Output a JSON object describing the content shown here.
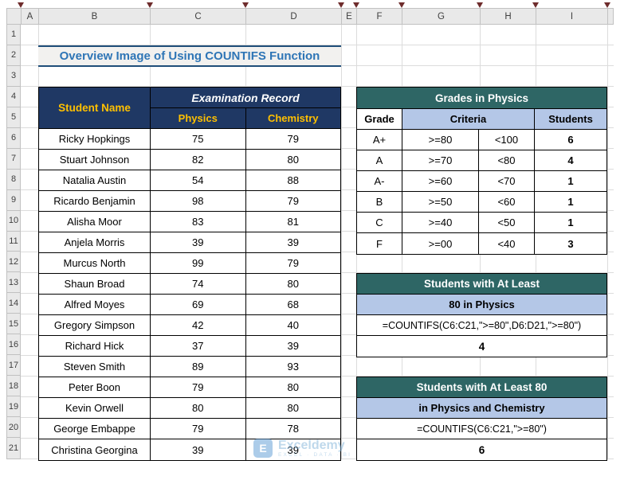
{
  "colors": {
    "navy_header": "#1F3864",
    "gold_text": "#FFC000",
    "teal_header": "#2E6665",
    "light_blue": "#B4C7E7",
    "title_text": "#2E75B6",
    "title_border": "#1F4E79"
  },
  "column_headers": [
    "A",
    "B",
    "C",
    "D",
    "E",
    "F",
    "G",
    "H",
    "I"
  ],
  "row_numbers": [
    "1",
    "2",
    "3",
    "4",
    "5",
    "6",
    "7",
    "8",
    "9",
    "10",
    "11",
    "12",
    "13",
    "14",
    "15",
    "16",
    "17",
    "18",
    "19",
    "20",
    "21"
  ],
  "title": "Overview Image of Using COUNTIFS Function",
  "student_table": {
    "name_header": "Student Name",
    "group_header": "Examination Record",
    "col_physics": "Physics",
    "col_chemistry": "Chemistry",
    "rows": [
      [
        "Ricky Hopkings",
        "75",
        "79"
      ],
      [
        "Stuart Johnson",
        "82",
        "80"
      ],
      [
        "Natalia Austin",
        "54",
        "88"
      ],
      [
        "Ricardo Benjamin",
        "98",
        "79"
      ],
      [
        "Alisha Moor",
        "83",
        "81"
      ],
      [
        "Anjela Morris",
        "39",
        "39"
      ],
      [
        "Murcus North",
        "99",
        "79"
      ],
      [
        "Shaun Broad",
        "74",
        "80"
      ],
      [
        "Alfred Moyes",
        "69",
        "68"
      ],
      [
        "Gregory Simpson",
        "42",
        "40"
      ],
      [
        "Richard Hick",
        "37",
        "39"
      ],
      [
        "Steven Smith",
        "89",
        "93"
      ],
      [
        "Peter Boon",
        "79",
        "80"
      ],
      [
        "Kevin Orwell",
        "80",
        "80"
      ],
      [
        "George Embappe",
        "79",
        "78"
      ],
      [
        "Christina Georgina",
        "39",
        "39"
      ]
    ]
  },
  "grades_table": {
    "title": "Grades in Physics",
    "grade_header": "Grade",
    "criteria_header": "Criteria",
    "students_header": "Students",
    "rows": [
      [
        "A+",
        ">=80",
        "<100",
        "6"
      ],
      [
        "A",
        ">=70",
        "<80",
        "4"
      ],
      [
        "A-",
        ">=60",
        "<70",
        "1"
      ],
      [
        "B",
        ">=50",
        "<60",
        "1"
      ],
      [
        "C",
        ">=40",
        "<50",
        "1"
      ],
      [
        "F",
        ">=00",
        "<40",
        "3"
      ]
    ]
  },
  "countifs_box_1": {
    "title": "Students with At Least",
    "subtitle": "80 in Physics",
    "formula": "=COUNTIFS(C6:C21,\">=80\",D6:D21,\">=80\")",
    "result": "4"
  },
  "countifs_box_2": {
    "title": "Students with At Least 80",
    "subtitle": "in Physics and Chemistry",
    "formula": "=COUNTIFS(C6:C21,\">=80\")",
    "result": "6"
  },
  "watermark": {
    "brand": "Exceldemy",
    "tagline": "EXCEL · DATA · BI"
  }
}
